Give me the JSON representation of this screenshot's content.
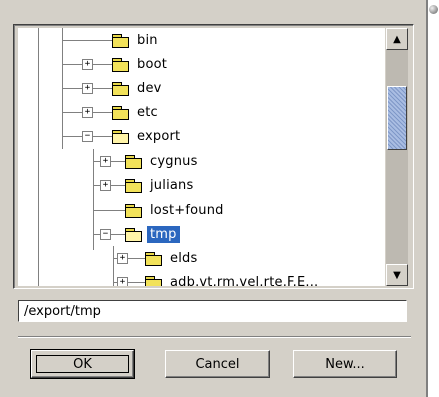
{
  "tree": {
    "items": [
      {
        "label": "bin",
        "expander": ""
      },
      {
        "label": "boot",
        "expander": "+"
      },
      {
        "label": "dev",
        "expander": "+"
      },
      {
        "label": "etc",
        "expander": "+"
      },
      {
        "label": "export",
        "expander": "−"
      },
      {
        "label": "cygnus",
        "expander": "+"
      },
      {
        "label": "julians",
        "expander": "+"
      },
      {
        "label": "lost+found",
        "expander": ""
      },
      {
        "label": "tmp",
        "expander": "−"
      },
      {
        "label": "elds",
        "expander": "+"
      },
      {
        "label": "adb.vt.rm.vel.rte.F.E...",
        "expander": "+"
      }
    ]
  },
  "scrollbar": {
    "up_glyph": "▲",
    "down_glyph": "▼"
  },
  "path": {
    "value": "/export/tmp"
  },
  "buttons": {
    "ok": "OK",
    "cancel": "Cancel",
    "new": "New..."
  }
}
